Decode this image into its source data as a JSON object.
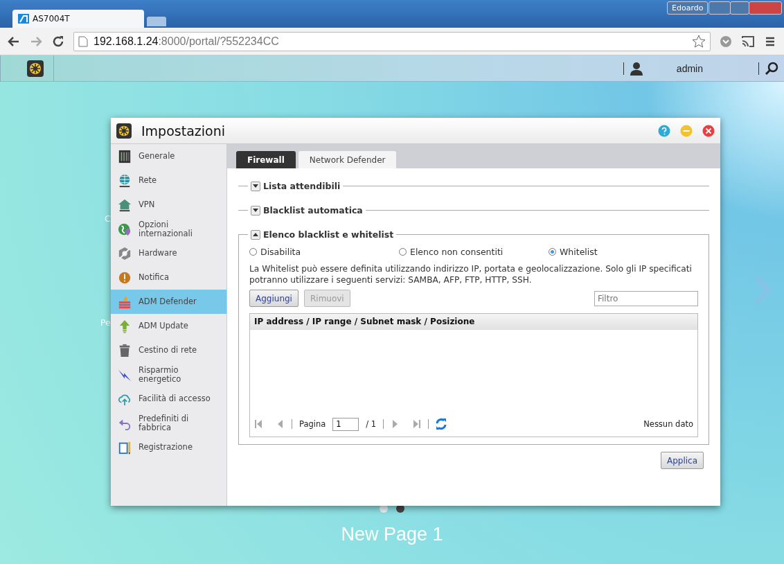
{
  "browser": {
    "tab_title": "AS7004T",
    "url_host": "192.168.1.24",
    "url_rest": ":8000/portal/?552234CC",
    "user": "Edoardo"
  },
  "top_bar": {
    "user": "admin"
  },
  "desktop": {
    "labels": [
      "C",
      "Pe"
    ],
    "page_dots": [
      {
        "selected": false
      },
      {
        "selected": true
      }
    ],
    "page_title": "New Page 1"
  },
  "window": {
    "title": "Impostazioni"
  },
  "sidebar": {
    "items": [
      {
        "label": "Generale",
        "kind": "server",
        "selected": false
      },
      {
        "label": "Rete",
        "kind": "globe",
        "selected": false
      },
      {
        "label": "VPN",
        "kind": "house",
        "selected": false
      },
      {
        "label": "Opzioni internazionali",
        "kind": "earth",
        "selected": false
      },
      {
        "label": "Hardware",
        "kind": "hardware",
        "selected": false
      },
      {
        "label": "Notifica",
        "kind": "alert",
        "selected": false
      },
      {
        "label": "ADM Defender",
        "kind": "firewall",
        "selected": true
      },
      {
        "label": "ADM Update",
        "kind": "update",
        "selected": false
      },
      {
        "label": "Cestino di rete",
        "kind": "trash",
        "selected": false
      },
      {
        "label": "Risparmio energetico",
        "kind": "bolt",
        "selected": false
      },
      {
        "label": "Facilità di accesso",
        "kind": "cloud",
        "selected": false
      },
      {
        "label": "Predefiniti di fabbrica",
        "kind": "undo",
        "selected": false
      },
      {
        "label": "Registrazione",
        "kind": "log",
        "selected": false
      }
    ]
  },
  "tabs": [
    {
      "label": "Firewall",
      "selected": true
    },
    {
      "label": "Network Defender",
      "selected": false
    }
  ],
  "sections": [
    {
      "title": "Lista attendibili",
      "expanded": false
    },
    {
      "title": "Blacklist automatica",
      "expanded": false
    },
    {
      "title": "Elenco blacklist e whitelist",
      "expanded": true,
      "content": {
        "options": [
          {
            "label": "Disabilita",
            "selected": false
          },
          {
            "label": "Elenco non consentiti",
            "selected": false
          },
          {
            "label": "Whitelist",
            "selected": true
          }
        ],
        "description": "La Whitelist può essere definita utilizzando indirizzo IP, portata e geolocalizzazione. Solo gli IP specificati potranno utilizzare i seguenti servizi: SAMBA, AFP, FTP, HTTP, SSH.",
        "buttons": [
          {
            "label": "Aggiungi",
            "disabled": false
          },
          {
            "label": "Rimuovi",
            "disabled": true
          }
        ],
        "filter": {
          "placeholder": "Filtro"
        },
        "table": {
          "columns": [
            "IP address / IP range / Subnet mask / Posizione"
          ]
        },
        "pager": {
          "label": "Pagina",
          "page": "1",
          "total": "/ 1",
          "status": "Nessun dato"
        }
      }
    }
  ],
  "apply_button": "Applica"
}
